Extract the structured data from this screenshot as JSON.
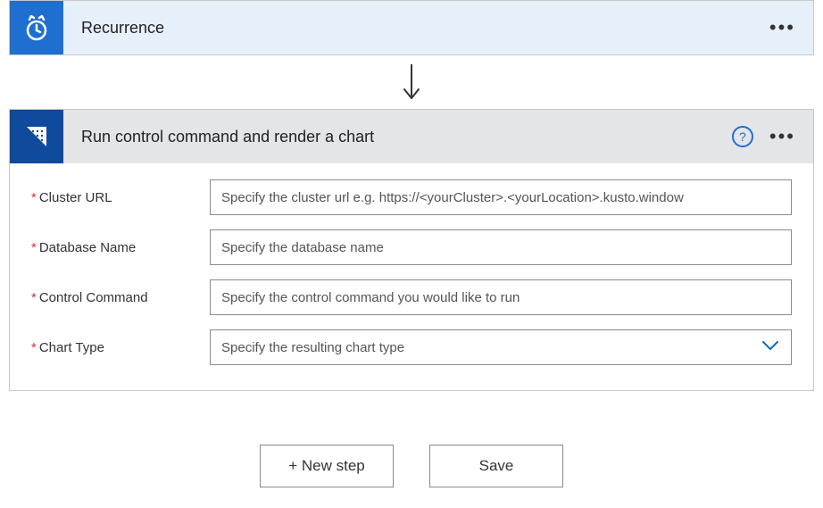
{
  "recurrence": {
    "title": "Recurrence"
  },
  "kusto": {
    "title": "Run control command and render a chart",
    "fields": {
      "clusterUrl": {
        "label": "Cluster URL",
        "placeholder": "Specify the cluster url e.g. https://<yourCluster>.<yourLocation>.kusto.window"
      },
      "databaseName": {
        "label": "Database Name",
        "placeholder": "Specify the database name"
      },
      "controlCommand": {
        "label": "Control Command",
        "placeholder": "Specify the control command you would like to run"
      },
      "chartType": {
        "label": "Chart Type",
        "placeholder": "Specify the resulting chart type"
      }
    }
  },
  "actions": {
    "newStep": "+ New step",
    "save": "Save"
  },
  "help": "?"
}
